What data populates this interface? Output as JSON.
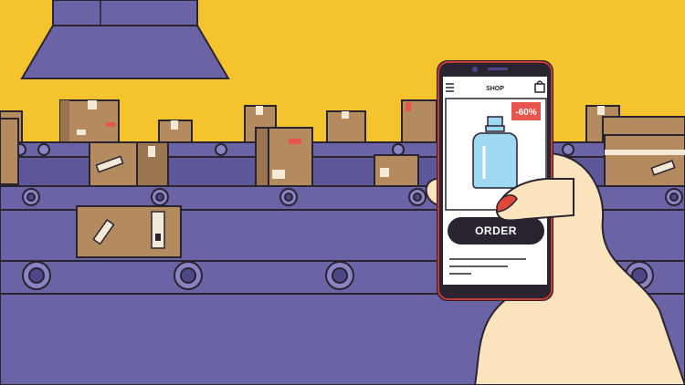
{
  "colors": {
    "background": "#f5c32c",
    "belt": "#6a63a6",
    "belt_dark": "#4d4787",
    "box": "#b48b5f",
    "box_dark": "#9a7550",
    "outline": "#2a2330",
    "phone_frame": "#c63a34",
    "discount_badge": "#e8554c",
    "bottle": "#9fd8f2",
    "skin": "#fbe3bd",
    "nail": "#e0463c"
  },
  "phone": {
    "header": {
      "title": "SHOP",
      "menu_icon": "hamburger-icon",
      "bag_icon": "bag-icon"
    },
    "product": {
      "discount": "-60%",
      "image": "bottle-icon"
    },
    "order_button": "ORDER"
  }
}
